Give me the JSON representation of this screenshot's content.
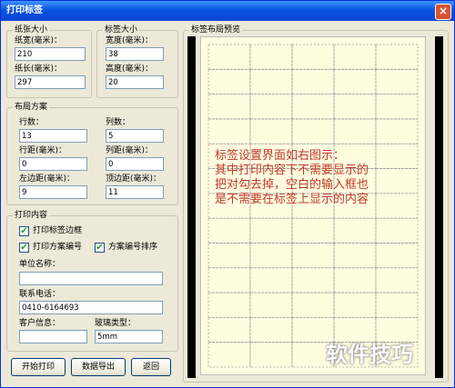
{
  "window": {
    "title": "打印标签",
    "close_glyph": "×"
  },
  "paper_size": {
    "caption": "纸张大小",
    "width_label": "纸宽(毫米)：",
    "width_value": "210",
    "length_label": "纸长(毫米)：",
    "length_value": "297"
  },
  "label_size": {
    "caption": "标签大小",
    "width_label": "宽度(毫米)：",
    "width_value": "38",
    "height_label": "高度(毫米)：",
    "height_value": "20"
  },
  "layout": {
    "caption": "布局方案",
    "rows_label": "行数：",
    "rows_value": "13",
    "cols_label": "列数：",
    "cols_value": "5",
    "row_gap_label": "行距(毫米)：",
    "row_gap_value": "0",
    "col_gap_label": "列距(毫米)：",
    "col_gap_value": "0",
    "left_margin_label": "左边距(毫米)：",
    "left_margin_value": "9",
    "top_margin_label": "顶边距(毫米)：",
    "top_margin_value": "11"
  },
  "print_content": {
    "caption": "打印内容",
    "print_border_label": "打印标签边框",
    "print_border_checked": true,
    "print_scheme_no_label": "打印方案编号",
    "print_scheme_no_checked": true,
    "scheme_no_sort_label": "方案编号排序",
    "scheme_no_sort_checked": true,
    "unit_name_label": "单位名称：",
    "unit_name_value": "",
    "phone_label": "联系电话：",
    "phone_value": "0410-6164693",
    "customer_label": "客户信息：",
    "customer_value": "",
    "glass_type_label": "玻璃类型：",
    "glass_type_value": "5mm"
  },
  "buttons": {
    "start_print": "开始打印",
    "export": "数据导出",
    "back": "返回"
  },
  "preview": {
    "caption": "标签布局预览",
    "note_lines": [
      "标签设置界面如右图示：",
      "其中打印内容下不需要显示的",
      "把对勾去掉，空白的输入框也",
      "是不需要在标签上显示的内容"
    ],
    "grid_rows": 13,
    "grid_cols": 5
  },
  "colors": {
    "note": "#c0392b",
    "preview_bg": "#fffde0",
    "title_bar": "#0a53e0"
  },
  "watermark": "软件技巧"
}
